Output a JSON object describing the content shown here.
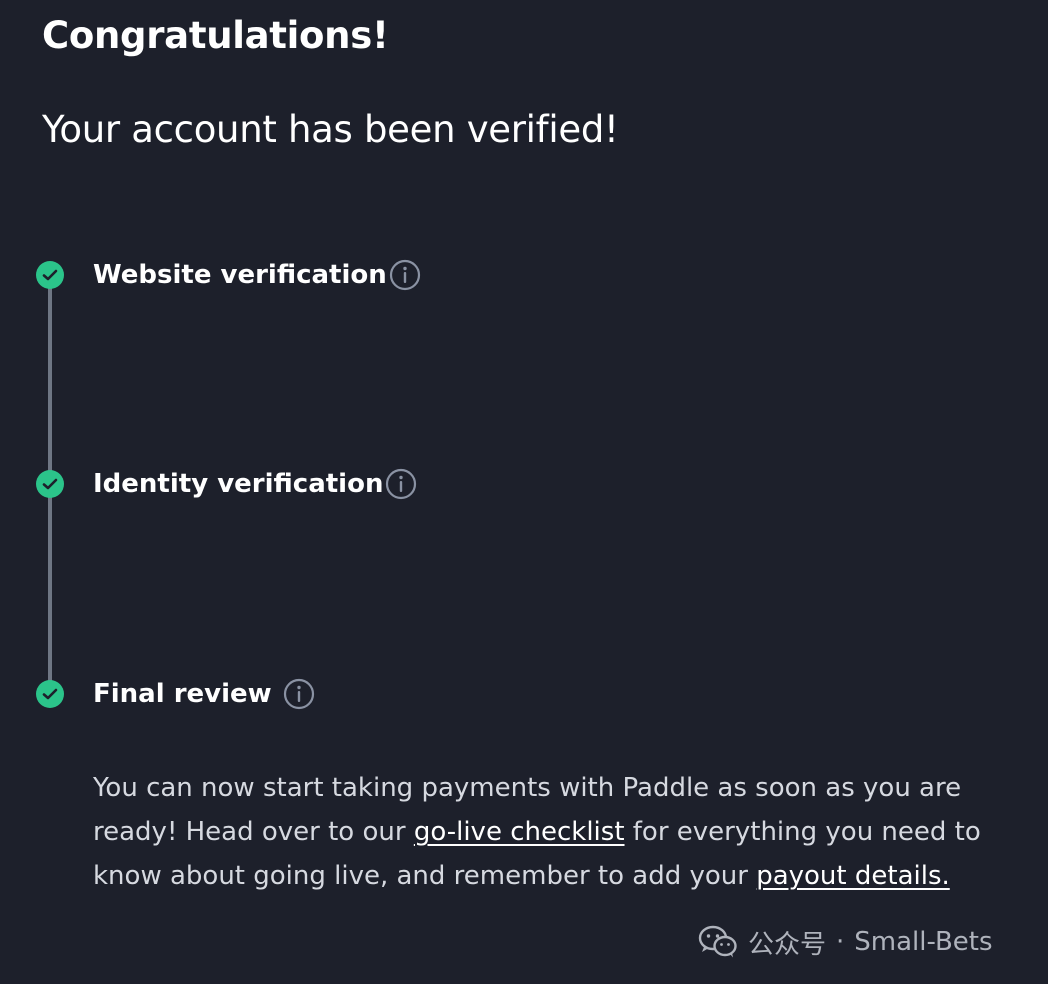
{
  "header": {
    "title": "Congratulations!",
    "subtitle": "Your account has been verified!"
  },
  "steps": [
    {
      "label": "Website verification",
      "status": "complete",
      "icon": "check-icon",
      "info_icon": "info-icon"
    },
    {
      "label": "Identity verification",
      "status": "complete",
      "icon": "check-icon",
      "info_icon": "info-icon"
    },
    {
      "label": "Final review",
      "status": "complete",
      "icon": "check-icon",
      "info_icon": "info-icon"
    }
  ],
  "message": {
    "part1": "You can now start taking payments with Paddle as soon as you are ready! Head over to our ",
    "link1": "go-live checklist",
    "part2": " for everything you need to know about going live, and remember to add your ",
    "link2": "payout details."
  },
  "watermark": {
    "icon": "wechat-icon",
    "label": "公众号",
    "separator": "·",
    "account": "Small-Bets"
  },
  "colors": {
    "background": "#1d202b",
    "check": "#2bc48a",
    "line": "#6e7684",
    "info_icon": "#8a92a3"
  }
}
